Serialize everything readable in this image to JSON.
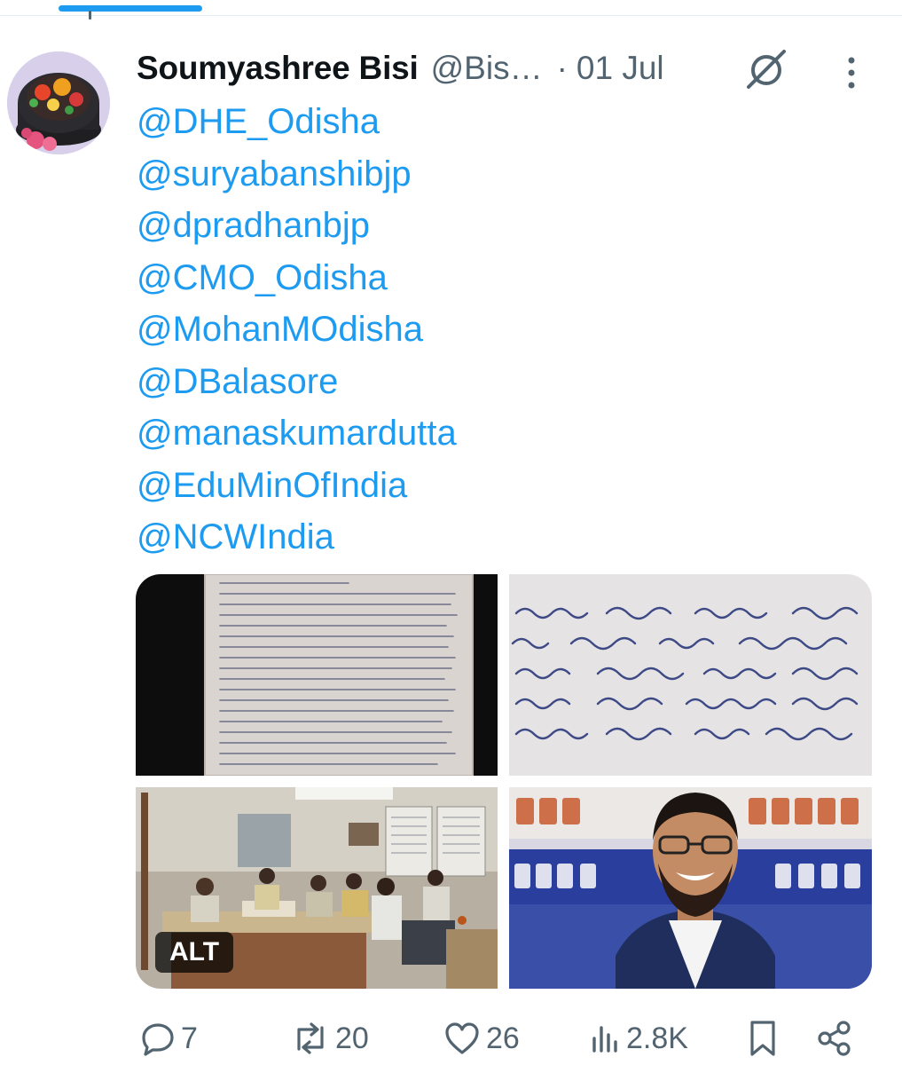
{
  "tweet": {
    "author": {
      "display_name": "Soumyashree Bisi",
      "handle": "@Bis…",
      "avatar": "decorated-lacquer-box-avatar"
    },
    "separator": "·",
    "date": "01 Jul",
    "icons": {
      "grok": "grok-icon",
      "more": "more-vertical-icon"
    },
    "mentions": [
      "@DHE_Odisha",
      "@suryabanshibjp",
      "@dpradhanbjp",
      "@CMO_Odisha",
      "@MohanMOdisha",
      "@DBalasore",
      "@manaskumardutta",
      "@EduMinOfIndia",
      "@NCWIndia"
    ],
    "media": {
      "photos": [
        {
          "name": "handwritten-letter-page-photo",
          "alt_badge": ""
        },
        {
          "name": "handwritten-letter-closeup-photo",
          "alt_badge": ""
        },
        {
          "name": "college-office-meeting-photo",
          "alt_badge": "ALT"
        },
        {
          "name": "smiling-man-portrait-photo",
          "alt_badge": ""
        }
      ]
    },
    "actions": {
      "replies": "7",
      "reposts": "20",
      "likes": "26",
      "views": "2.8K"
    },
    "colors": {
      "link": "#1d9bf0",
      "secondary_text": "#536471",
      "primary_text": "#0f1419"
    }
  }
}
